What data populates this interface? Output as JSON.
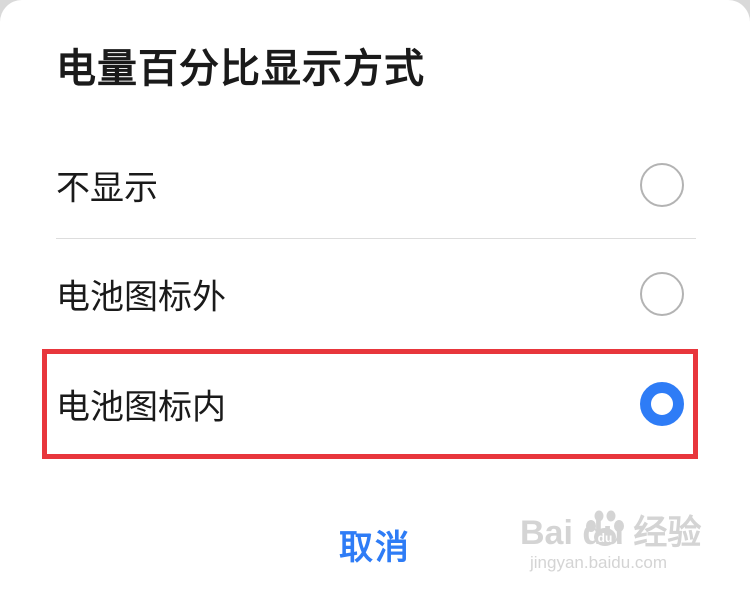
{
  "dialog": {
    "title": "电量百分比显示方式",
    "options": [
      {
        "label": "不显示",
        "selected": false
      },
      {
        "label": "电池图标外",
        "selected": false
      },
      {
        "label": "电池图标内",
        "selected": true
      }
    ],
    "cancel_label": "取消"
  },
  "colors": {
    "accent": "#2e7cf6",
    "highlight_border": "#e8363c",
    "radio_unchecked": "#b3b3b3",
    "divider": "#dddddd"
  },
  "watermark": {
    "brand": "Bai  du 经验",
    "url": "jingyan.baidu.com"
  }
}
